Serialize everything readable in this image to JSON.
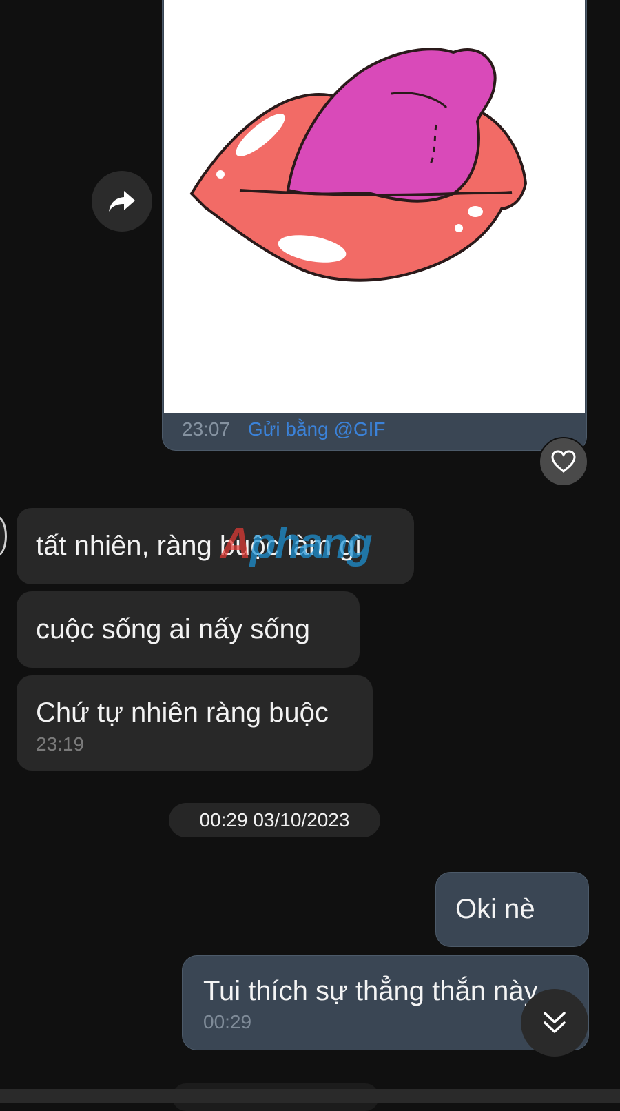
{
  "gif_message": {
    "time": "23:07",
    "via": "Gửi bằng @GIF"
  },
  "incoming": [
    {
      "text": "tất nhiên, ràng buộc làm gì"
    },
    {
      "text": "cuộc sống ai nấy sống"
    },
    {
      "text": "Chứ tự nhiên ràng buộc",
      "time": "23:19"
    }
  ],
  "watermark": {
    "part1": "A",
    "part2": "phang"
  },
  "date_separator": "00:29 03/10/2023",
  "outgoing": [
    {
      "text": "Oki nè"
    },
    {
      "text": "Tui thích sự thẳng thắn này",
      "time": "00:29"
    }
  ],
  "icons": {
    "forward": "forward-arrow-icon",
    "reaction": "heart-icon",
    "scroll_down": "double-chevron-down-icon"
  },
  "colors": {
    "background": "#101010",
    "incoming_bubble": "#282828",
    "outgoing_bubble": "#3a4654",
    "link": "#3b82d9"
  }
}
